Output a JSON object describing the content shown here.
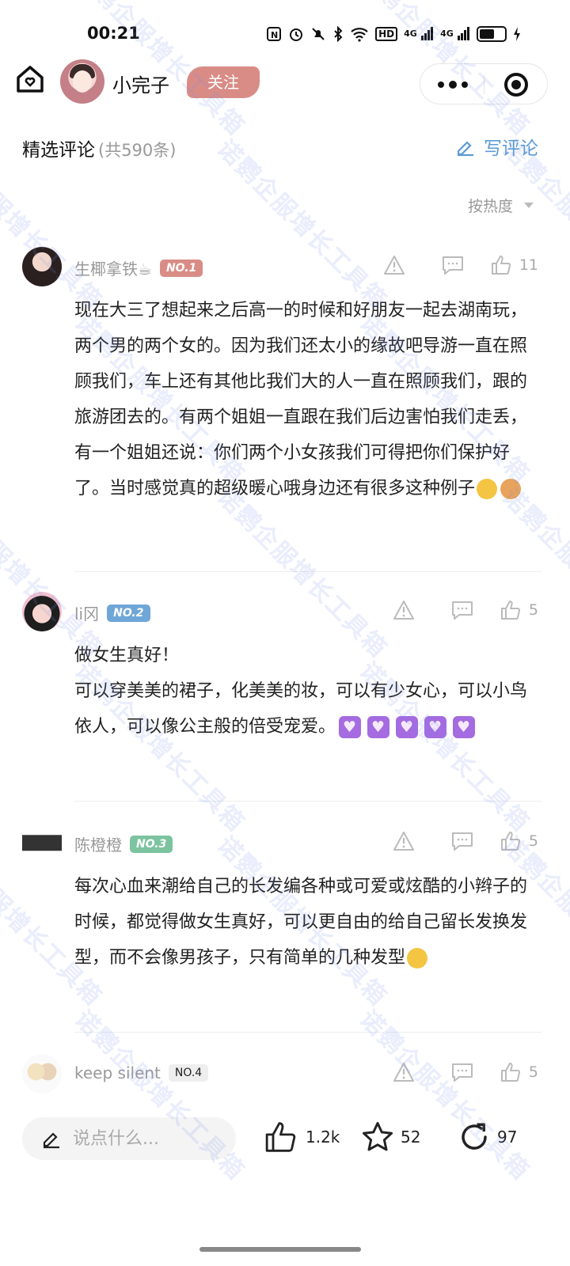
{
  "status_bar": {
    "time": "00:21",
    "network": [
      "4G",
      "4G"
    ],
    "hd_label": "HD",
    "battery_level": 0.6
  },
  "header": {
    "author_name": "小完子",
    "follow_label": "关注",
    "more_icon": "more-icon",
    "target_icon": "target-icon",
    "home_icon": "home-icon"
  },
  "section": {
    "title": "精选评论",
    "count": "(共590条)",
    "write_label": "写评论",
    "sort_label": "按热度"
  },
  "comments": [
    {
      "name": "生椰拿铁☕",
      "rank": "NO.1",
      "likes": "11",
      "body": "现在大三了想起来之后高一的时候和好朋友一起去湖南玩，两个男的两个女的。因为我们还太小的缘故吧导游一直在照顾我们，车上还有其他比我们大的人一直在照顾我们，跟的旅游团去的。有两个姐姐一直跟在我们后边害怕我们走丢，有一个姐姐还说：你们两个小女孩我们可得把你们保护好了。当时感觉真的超级暖心哦身边还有很多这种例子"
    },
    {
      "name": "li冈",
      "rank": "NO.2",
      "likes": "5",
      "body_line1": "做女生真好！",
      "body": "可以穿美美的裙子，化美美的妆，可以有少女心，可以小鸟依人，可以像公主般的倍受宠爱。"
    },
    {
      "name": "陈橙橙",
      "rank": "NO.3",
      "likes": "5",
      "body": "每次心血来潮给自己的长发编各种或可爱或炫酷的小辫子的时候，都觉得做女生真好，可以更自由的给自己留长发换发型，而不会像男孩子，只有简单的几种发型"
    },
    {
      "name": "keep silent",
      "rank": "NO.4",
      "likes": "5",
      "body": ""
    }
  ],
  "bottom_bar": {
    "input_placeholder": "说点什么...",
    "likes": "1.2k",
    "favorites": "52",
    "shares": "97"
  },
  "watermark": "诺鹦企服增长工具箱",
  "colors": {
    "accent_blue": "#5b9bd5",
    "follow_pink": "#d98c86",
    "rank1": "#d98c86",
    "rank2": "#6fa6d8",
    "rank3": "#7cc3a0"
  }
}
